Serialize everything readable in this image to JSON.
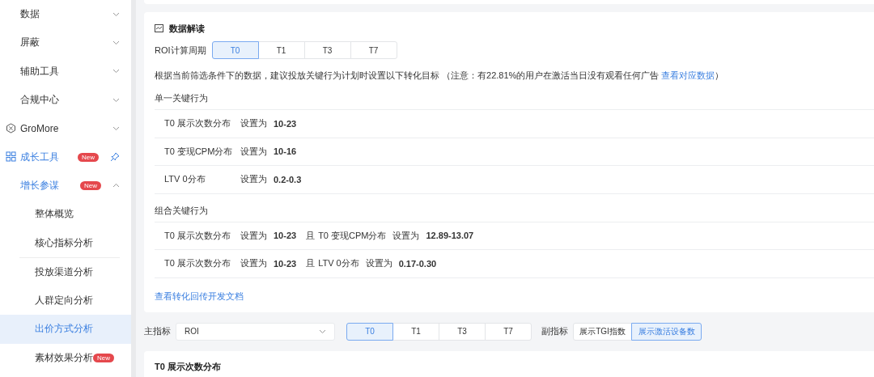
{
  "sidebar": {
    "items": [
      {
        "label": "数据",
        "kind": "plain",
        "expanded": false
      },
      {
        "label": "屏蔽",
        "kind": "plain",
        "expanded": false
      },
      {
        "label": "辅助工具",
        "kind": "plain",
        "expanded": false
      },
      {
        "label": "合规中心",
        "kind": "plain",
        "expanded": false
      },
      {
        "label": "GroMore",
        "kind": "hex",
        "expanded": false
      },
      {
        "label": "成长工具",
        "kind": "grid",
        "badge": "New",
        "pinned": true,
        "children": [
          {
            "label": "增长参谋",
            "badge": "New",
            "expanded": true,
            "children": [
              {
                "label": "整体概览",
                "selected": false
              },
              {
                "label": "核心指标分析",
                "selected": false,
                "divider": true
              },
              {
                "label": "投放渠道分析",
                "selected": false
              },
              {
                "label": "人群定向分析",
                "selected": false
              },
              {
                "label": "出价方式分析",
                "selected": true
              },
              {
                "label": "素材效果分析",
                "selected": false,
                "badge": "New"
              }
            ]
          }
        ]
      }
    ]
  },
  "insight": {
    "title": "数据解读",
    "period": {
      "label": "ROI计算周期",
      "options": [
        {
          "label": "T0",
          "selected": true
        },
        {
          "label": "T1",
          "selected": false
        },
        {
          "label": "T3",
          "selected": false
        },
        {
          "label": "T7",
          "selected": false
        }
      ]
    },
    "note": {
      "text": "根据当前筛选条件下的数据，建议投放关键行为计划时设置以下转化目标 （注意：有22.81%的用户在激活当日没有观看任何广告 ",
      "link": "查看对应数据",
      "suffix": "）"
    },
    "groups": [
      {
        "title": "单一关键行为",
        "rows": [
          {
            "conditions": [
              {
                "metric": "T0 展示次数分布",
                "set": "设置为",
                "value": "10-23"
              }
            ]
          },
          {
            "conditions": [
              {
                "metric": "T0 变现CPM分布",
                "set": "设置为",
                "value": "10-16"
              }
            ]
          },
          {
            "conditions": [
              {
                "metric": "LTV 0分布",
                "set": "设置为",
                "value": "0.2-0.3"
              }
            ]
          }
        ]
      },
      {
        "title": "组合关键行为",
        "rows": [
          {
            "conditions": [
              {
                "metric": "T0 展示次数分布",
                "set": "设置为",
                "value": "10-23"
              },
              {
                "joiner": "且",
                "metric": "T0 变现CPM分布",
                "set": "设置为",
                "value": "12.89-13.07"
              }
            ]
          },
          {
            "conditions": [
              {
                "metric": "T0 展示次数分布",
                "set": "设置为",
                "value": "10-23"
              },
              {
                "joiner": "且",
                "metric": "LTV 0分布",
                "set": "设置为",
                "value": "0.17-0.30"
              }
            ]
          }
        ]
      }
    ],
    "doc_link": "查看转化回传开发文档"
  },
  "filters": {
    "main_label": "主指标",
    "main_value": "ROI",
    "periods": [
      {
        "label": "T0",
        "selected": true
      },
      {
        "label": "T1",
        "selected": false
      },
      {
        "label": "T3",
        "selected": false
      },
      {
        "label": "T7",
        "selected": false
      }
    ],
    "secondary_label": "副指标",
    "secondary": [
      {
        "label": "展示TGI指数",
        "selected": false
      },
      {
        "label": "展示激活设备数",
        "selected": true
      }
    ]
  },
  "chart_card": {
    "title": "T0 展示次数分布"
  }
}
